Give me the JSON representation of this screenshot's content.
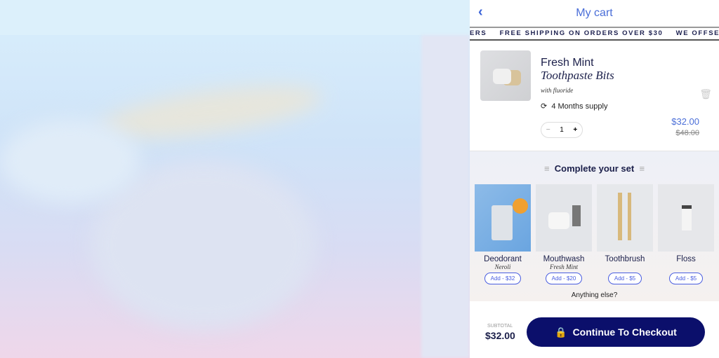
{
  "cart": {
    "title": "My cart",
    "ticker": [
      "ERS",
      "FREE SHIPPING ON ORDERS OVER $30",
      "WE OFFSET EMIS"
    ],
    "item": {
      "name": "Fresh Mint",
      "subname": "Toothpaste Bits",
      "variant": "with fluoride",
      "supply": "4 Months supply",
      "quantity": "1",
      "price": "$32.00",
      "old_price": "$48.00"
    },
    "upsell": {
      "heading": "Complete your set",
      "products": [
        {
          "name": "Deodorant",
          "sub": "Neroli",
          "add": "Add - $32"
        },
        {
          "name": "Mouthwash",
          "sub": "Fresh Mint",
          "add": "Add - $20"
        },
        {
          "name": "Toothbrush",
          "sub": "",
          "add": "Add - $5"
        },
        {
          "name": "Floss",
          "sub": "",
          "add": "Add - $5"
        }
      ],
      "more": "Anything else?"
    },
    "footer": {
      "subtotal_label": "SUBTOTAL",
      "subtotal": "$32.00",
      "checkout": "Continue To Checkout"
    }
  },
  "colors": {
    "accent": "#4a6ed8",
    "checkout": "#0b0f6b"
  }
}
